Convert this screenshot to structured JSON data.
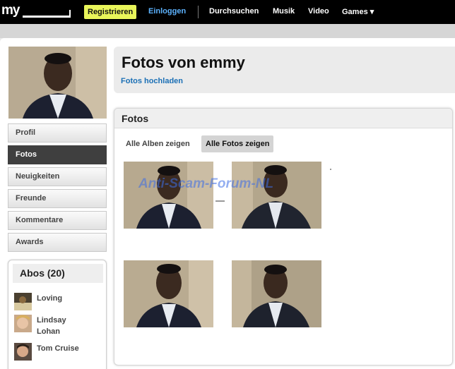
{
  "topnav": {
    "logo": "my",
    "register_label": "Registrieren",
    "login_label": "Einloggen",
    "items": [
      {
        "label": "Durchsuchen"
      },
      {
        "label": "Musik"
      },
      {
        "label": "Video"
      },
      {
        "label": "Games ▾"
      }
    ]
  },
  "sidebar": {
    "menu": [
      {
        "label": "Profil",
        "active": false
      },
      {
        "label": "Fotos",
        "active": true
      },
      {
        "label": "Neuigkeiten",
        "active": false
      },
      {
        "label": "Freunde",
        "active": false
      },
      {
        "label": "Kommentare",
        "active": false
      },
      {
        "label": "Awards",
        "active": false
      }
    ],
    "abos": {
      "title": "Abos (20)",
      "items": [
        {
          "name": "Loving"
        },
        {
          "name": "Lindsay Lohan"
        },
        {
          "name": "Tom Cruise"
        }
      ]
    }
  },
  "header": {
    "title": "Fotos von emmy",
    "upload_label": "Fotos hochladen"
  },
  "photos": {
    "title": "Fotos",
    "tabs": [
      {
        "label": "Alle Alben zeigen",
        "active": false
      },
      {
        "label": "Alle Fotos zeigen",
        "active": true
      }
    ],
    "watermark": "Anti-Scam-Forum-NL"
  },
  "colors": {
    "register_bg": "#e9f55a",
    "login_link": "#5db3ff",
    "upload_link": "#1a6fb5",
    "active_menu": "#3f3f3f"
  }
}
